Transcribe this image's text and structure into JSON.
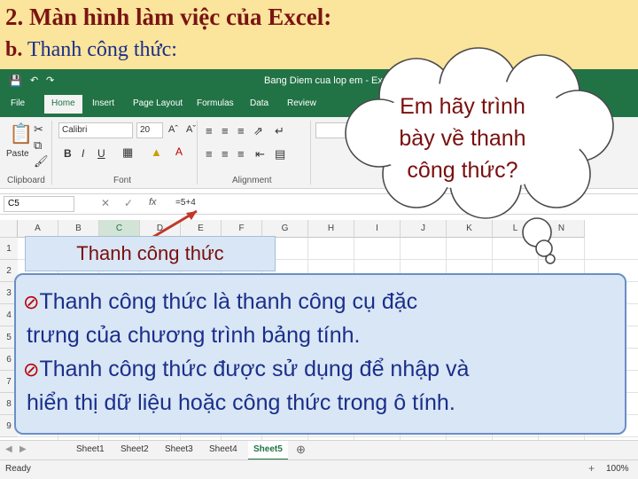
{
  "slide": {
    "title": "2. Màn hình làm việc của Excel:",
    "subtitle_lead": "b.",
    "subtitle_rest": " Thanh công thức:"
  },
  "excel": {
    "window_title": "Bang Diem cua lop em - Exce",
    "tabs": [
      "File",
      "Home",
      "Insert",
      "Page Layout",
      "Formulas",
      "Data",
      "Review"
    ],
    "active_tab": "Home",
    "font_name": "Calibri",
    "font_size": "20",
    "groups": [
      "Clipboard",
      "Font",
      "Alignment"
    ],
    "paste_label": "Paste",
    "namebox": "C5",
    "fx_label": "fx",
    "formula": "=5+4",
    "columns": [
      "A",
      "B",
      "C",
      "D",
      "E",
      "F",
      "G",
      "H",
      "I",
      "J",
      "K",
      "L",
      "N"
    ],
    "selected_column": "C",
    "rows": [
      "1",
      "2",
      "3",
      "4",
      "5",
      "6",
      "7",
      "8",
      "9"
    ],
    "sheets": [
      "Sheet1",
      "Sheet2",
      "Sheet3",
      "Sheet4",
      "Sheet5"
    ],
    "active_sheet": "Sheet5",
    "status": "Ready",
    "zoom": "100%"
  },
  "callout_label": "Thanh công thức",
  "cloud": {
    "line1": "Em hãy trình",
    "line2": "bày về thanh",
    "line3": "công thức?"
  },
  "note": {
    "bullet_icon": "no-entry-bullet-icon",
    "line1": "Thanh công thức là thanh công cụ đặc",
    "line2": "trưng của chương trình bảng tính.",
    "line3": "Thanh công thức được sử dụng để nhập và",
    "line4": "hiển thị dữ liệu hoặc công thức trong ô tính."
  },
  "colors": {
    "slide_bg": "#fbe49b",
    "excel_green": "#217346",
    "note_bg": "#d9e6f5",
    "title_red": "#7a1414",
    "text_blue": "#1a2f8a"
  }
}
